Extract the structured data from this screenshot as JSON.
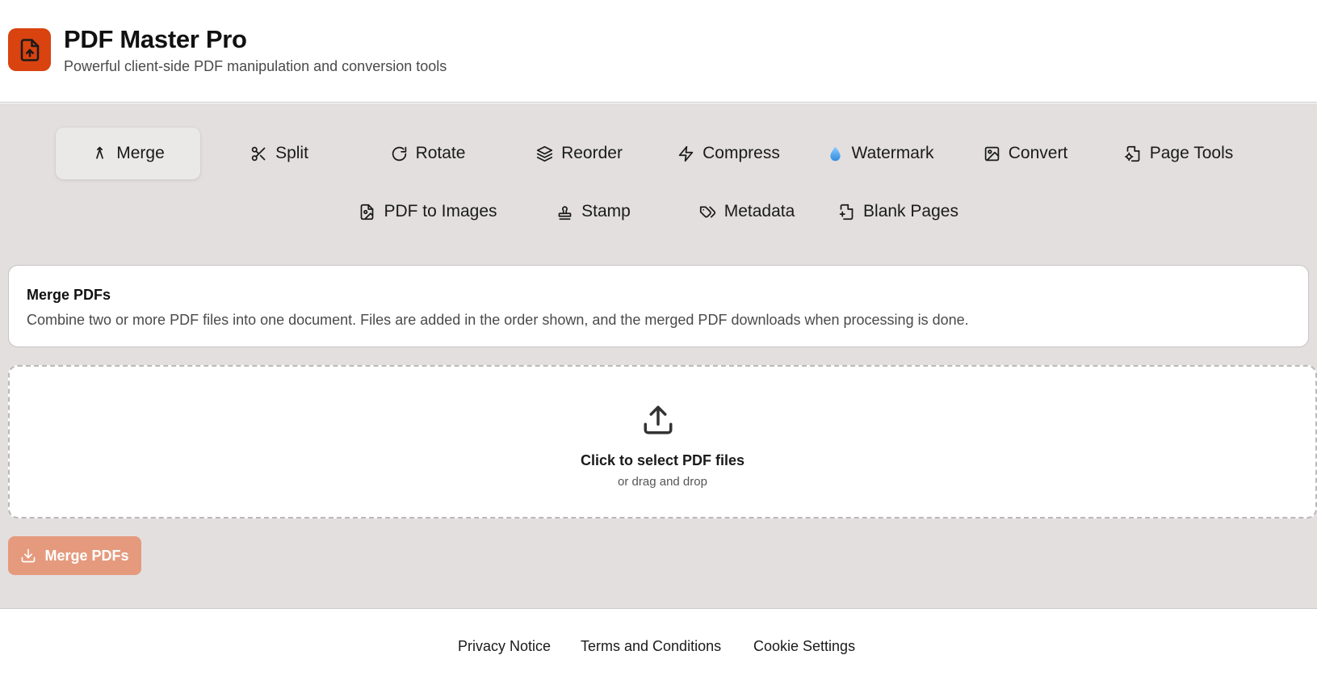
{
  "app": {
    "title": "PDF Master Pro",
    "subtitle": "Powerful client-side PDF manipulation and conversion tools",
    "logo_icon": "file-upload-icon",
    "brand_color": "#d8430f"
  },
  "tabs": [
    {
      "label": "Merge",
      "icon": "merge-icon",
      "active": true
    },
    {
      "label": "Split",
      "icon": "scissors-icon",
      "active": false
    },
    {
      "label": "Rotate",
      "icon": "rotate-icon",
      "active": false
    },
    {
      "label": "Reorder",
      "icon": "layers-icon",
      "active": false
    },
    {
      "label": "Compress",
      "icon": "lightning-icon",
      "active": false
    },
    {
      "label": "Watermark",
      "icon": "droplet-icon",
      "active": false
    },
    {
      "label": "Convert",
      "icon": "image-icon",
      "active": false
    },
    {
      "label": "Page Tools",
      "icon": "file-cog-icon",
      "active": false
    },
    {
      "label": "PDF to Images",
      "icon": "file-image-icon",
      "active": false
    },
    {
      "label": "Stamp",
      "icon": "stamp-icon",
      "active": false
    },
    {
      "label": "Metadata",
      "icon": "tags-icon",
      "active": false
    },
    {
      "label": "Blank Pages",
      "icon": "file-plus-icon",
      "active": false
    }
  ],
  "info": {
    "title": "Merge PDFs",
    "description": "Combine two or more PDF files into one document. Files are added in the order shown, and the merged PDF downloads when processing is done."
  },
  "dropzone": {
    "title": "Click to select PDF files",
    "subtitle": "or drag and drop",
    "icon": "upload-icon"
  },
  "action": {
    "label": "Merge PDFs",
    "icon": "download-icon",
    "disabled_color": "#e59a7d"
  },
  "footer": {
    "links": [
      "Privacy Notice",
      "Terms and Conditions",
      "Cookie Settings"
    ]
  }
}
